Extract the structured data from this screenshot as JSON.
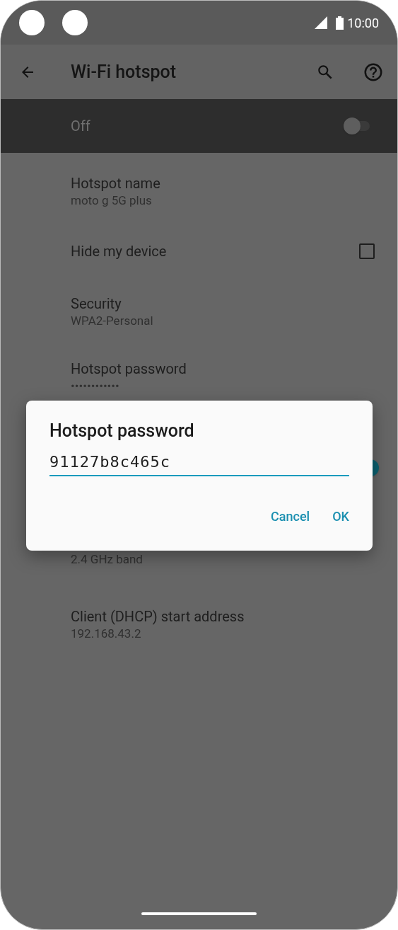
{
  "status_bar": {
    "time": "10:00"
  },
  "app_bar": {
    "title": "Wi-Fi hotspot"
  },
  "main_switch": {
    "label": "Off",
    "on": false
  },
  "items": [
    {
      "kind": "text",
      "title": "Hotspot name",
      "subtitle": "moto g 5G plus"
    },
    {
      "kind": "checkbox",
      "title": "Hide my device",
      "checked": false
    },
    {
      "kind": "text",
      "title": "Security",
      "subtitle": "WPA2-Personal"
    },
    {
      "kind": "text",
      "title": "Hotspot password",
      "subtitle": "••••••••••••"
    },
    {
      "kind": "switch",
      "on": true
    },
    {
      "kind": "text",
      "subtitle": "2.4 GHz band"
    },
    {
      "kind": "text",
      "title": "Client (DHCP) start address",
      "subtitle": "192.168.43.2"
    }
  ],
  "dialog": {
    "title": "Hotspot password",
    "value": "91127b8c465c",
    "buttons": [
      "Cancel",
      "OK"
    ]
  }
}
